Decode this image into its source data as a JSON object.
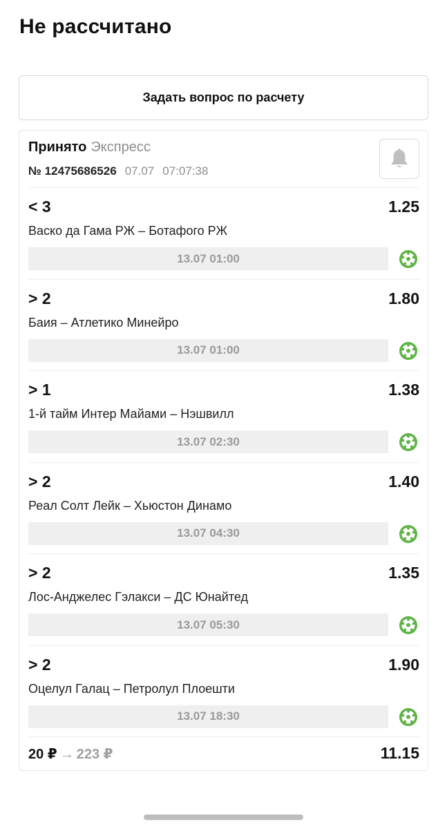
{
  "page_title": "Не рассчитано",
  "ask_button_label": "Задать вопрос по расчету",
  "bet": {
    "status": "Принято",
    "type": "Экспресс",
    "number": "№ 12475686526",
    "date": "07.07",
    "time": "07:07:38",
    "legs": [
      {
        "outcome": "< 3",
        "odds": "1.25",
        "event": "Васко да Гама РЖ – Ботафого РЖ",
        "start": "13.07 01:00",
        "sport_icon": "football-icon"
      },
      {
        "outcome": "> 2",
        "odds": "1.80",
        "event": "Баия – Атлетико Минейро",
        "start": "13.07 01:00",
        "sport_icon": "football-icon"
      },
      {
        "outcome": "> 1",
        "odds": "1.38",
        "event": "1-й тайм Интер Майами – Нэшвилл",
        "start": "13.07 02:30",
        "sport_icon": "football-icon"
      },
      {
        "outcome": "> 2",
        "odds": "1.40",
        "event": "Реал Солт Лейк – Хьюстон Динамо",
        "start": "13.07 04:30",
        "sport_icon": "football-icon"
      },
      {
        "outcome": "> 2",
        "odds": "1.35",
        "event": "Лос-Анджелес Гэлакси – ДС Юнайтед",
        "start": "13.07 05:30",
        "sport_icon": "football-icon"
      },
      {
        "outcome": "> 2",
        "odds": "1.90",
        "event": "Оцелул Галац – Петролул Плоешти",
        "start": "13.07 18:30",
        "sport_icon": "football-icon"
      }
    ],
    "stake": "20 ₽",
    "arrow": "→",
    "potential_win": "223 ₽",
    "total_odds": "11.15"
  },
  "icons": {
    "bell": "bell-icon",
    "sport": "football-icon"
  },
  "colors": {
    "accent_green": "#5fb446",
    "muted_text": "#8e8e8e",
    "time_bar_bg": "#efefef"
  }
}
